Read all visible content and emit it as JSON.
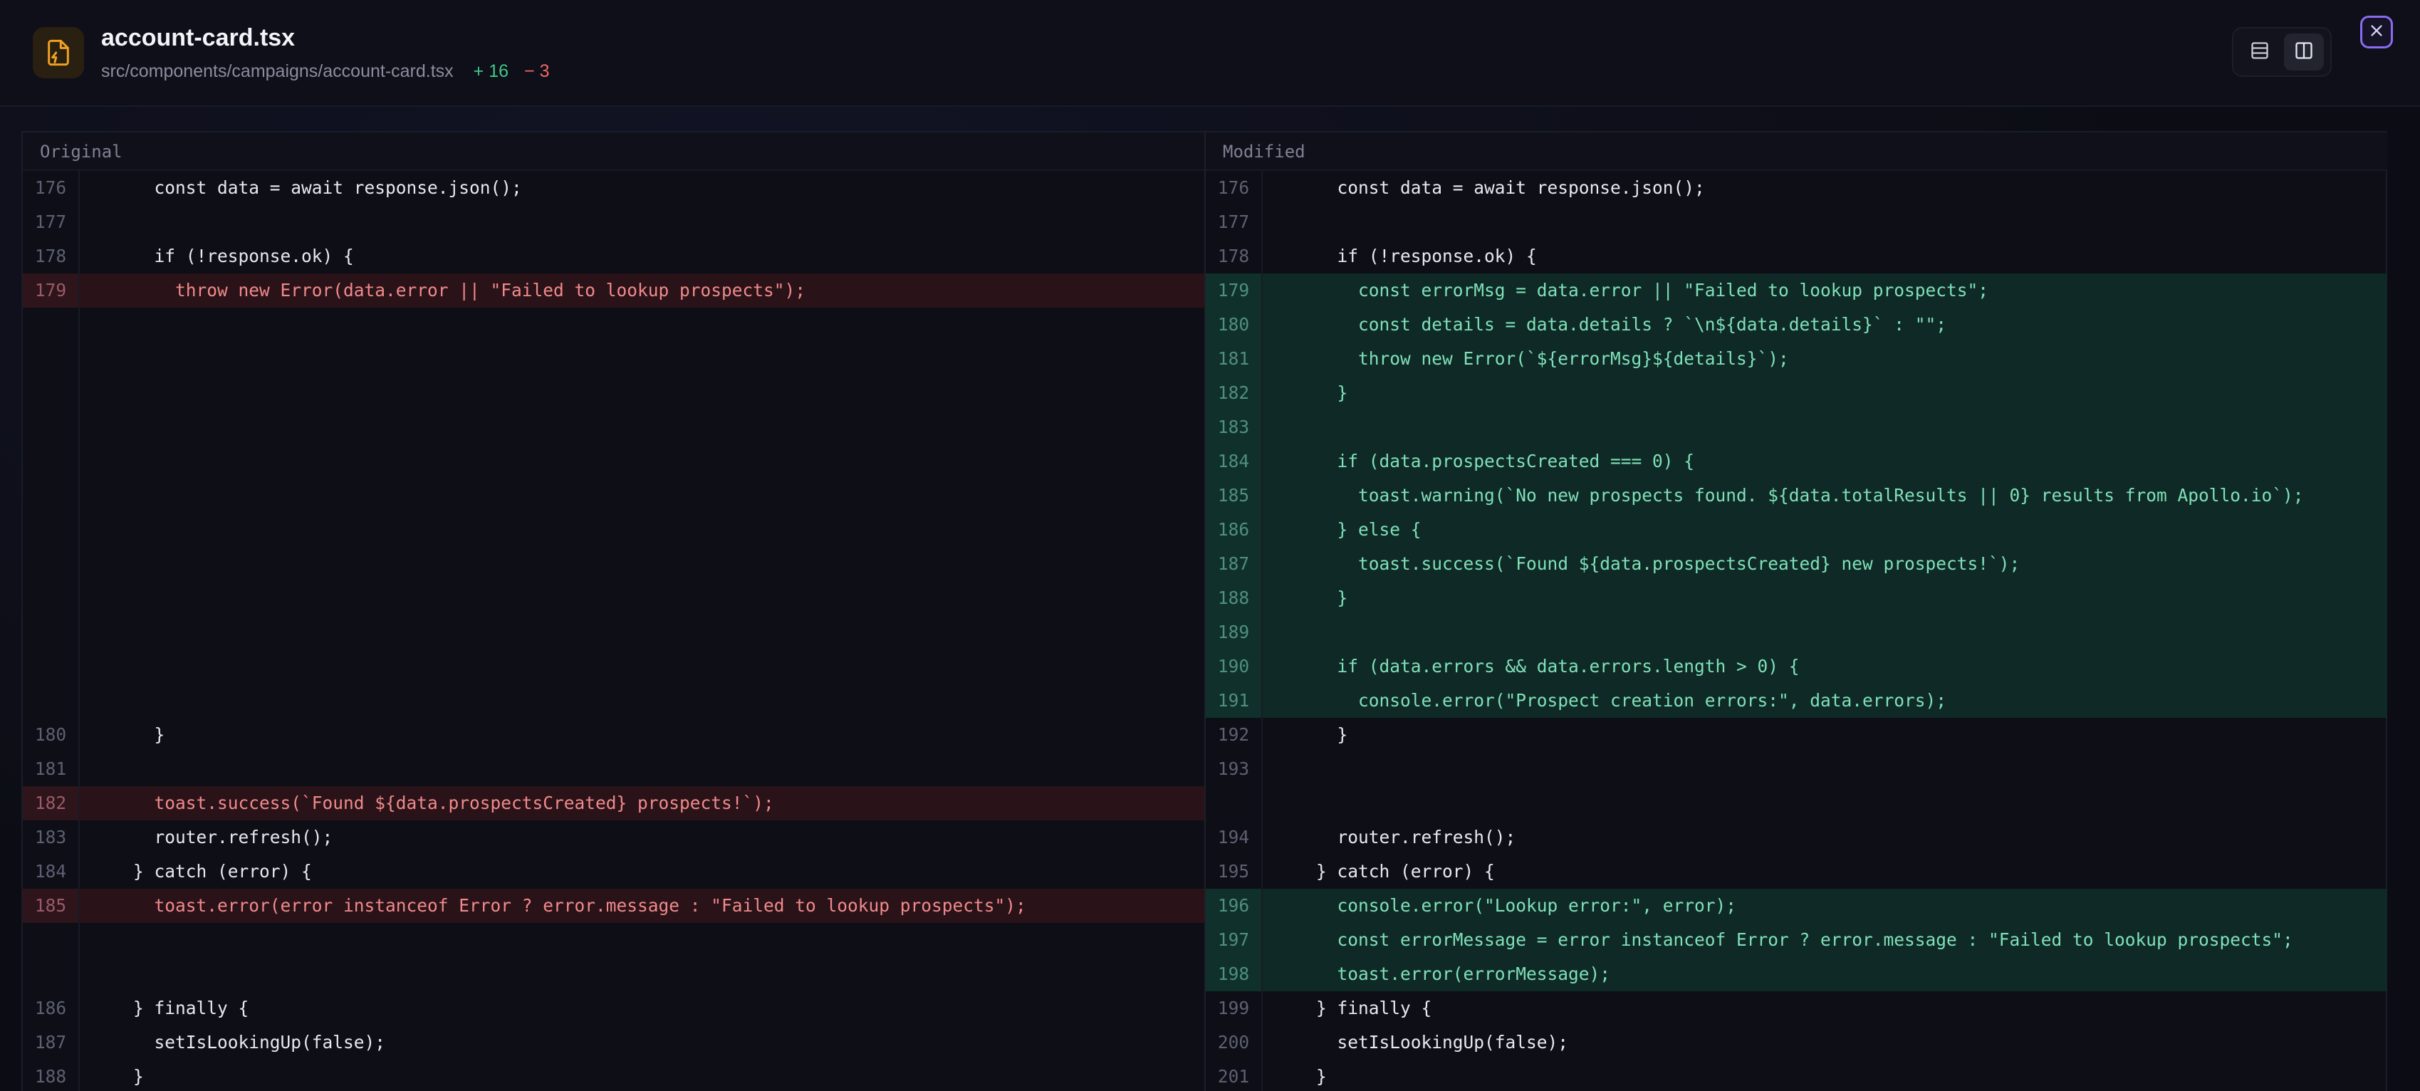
{
  "header": {
    "file_name": "account-card.tsx",
    "file_path": "src/components/campaigns/account-card.tsx",
    "additions": "+ 16",
    "deletions": "− 3"
  },
  "panes": {
    "left_label": "Original",
    "right_label": "Modified"
  },
  "left_lines": [
    {
      "n": "176",
      "t": "      const data = await response.json();",
      "k": "ctx"
    },
    {
      "n": "177",
      "t": "",
      "k": "ctx"
    },
    {
      "n": "178",
      "t": "      if (!response.ok) {",
      "k": "ctx"
    },
    {
      "n": "179",
      "t": "        throw new Error(data.error || \"Failed to lookup prospects\");",
      "k": "del"
    },
    {
      "n": "",
      "t": "",
      "k": "empty"
    },
    {
      "n": "",
      "t": "",
      "k": "empty"
    },
    {
      "n": "",
      "t": "",
      "k": "empty"
    },
    {
      "n": "",
      "t": "",
      "k": "empty"
    },
    {
      "n": "",
      "t": "",
      "k": "empty"
    },
    {
      "n": "",
      "t": "",
      "k": "empty"
    },
    {
      "n": "",
      "t": "",
      "k": "empty"
    },
    {
      "n": "",
      "t": "",
      "k": "empty"
    },
    {
      "n": "",
      "t": "",
      "k": "empty"
    },
    {
      "n": "",
      "t": "",
      "k": "empty"
    },
    {
      "n": "",
      "t": "",
      "k": "empty"
    },
    {
      "n": "",
      "t": "",
      "k": "empty"
    },
    {
      "n": "180",
      "t": "      }",
      "k": "ctx"
    },
    {
      "n": "181",
      "t": "",
      "k": "ctx"
    },
    {
      "n": "182",
      "t": "      toast.success(`Found ${data.prospectsCreated} prospects!`);",
      "k": "del"
    },
    {
      "n": "183",
      "t": "      router.refresh();",
      "k": "ctx"
    },
    {
      "n": "184",
      "t": "    } catch (error) {",
      "k": "ctx"
    },
    {
      "n": "185",
      "t": "      toast.error(error instanceof Error ? error.message : \"Failed to lookup prospects\");",
      "k": "del"
    },
    {
      "n": "",
      "t": "",
      "k": "empty"
    },
    {
      "n": "",
      "t": "",
      "k": "empty"
    },
    {
      "n": "186",
      "t": "    } finally {",
      "k": "ctx"
    },
    {
      "n": "187",
      "t": "      setIsLookingUp(false);",
      "k": "ctx"
    },
    {
      "n": "188",
      "t": "    }",
      "k": "ctx"
    }
  ],
  "right_lines": [
    {
      "n": "176",
      "t": "      const data = await response.json();",
      "k": "ctx"
    },
    {
      "n": "177",
      "t": "",
      "k": "ctx"
    },
    {
      "n": "178",
      "t": "      if (!response.ok) {",
      "k": "ctx"
    },
    {
      "n": "179",
      "t": "        const errorMsg = data.error || \"Failed to lookup prospects\";",
      "k": "add"
    },
    {
      "n": "180",
      "t": "        const details = data.details ? `\\n${data.details}` : \"\";",
      "k": "add"
    },
    {
      "n": "181",
      "t": "        throw new Error(`${errorMsg}${details}`);",
      "k": "add"
    },
    {
      "n": "182",
      "t": "      }",
      "k": "add"
    },
    {
      "n": "183",
      "t": "",
      "k": "add"
    },
    {
      "n": "184",
      "t": "      if (data.prospectsCreated === 0) {",
      "k": "add"
    },
    {
      "n": "185",
      "t": "        toast.warning(`No new prospects found. ${data.totalResults || 0} results from Apollo.io`);",
      "k": "add"
    },
    {
      "n": "186",
      "t": "      } else {",
      "k": "add"
    },
    {
      "n": "187",
      "t": "        toast.success(`Found ${data.prospectsCreated} new prospects!`);",
      "k": "add"
    },
    {
      "n": "188",
      "t": "      }",
      "k": "add"
    },
    {
      "n": "189",
      "t": "",
      "k": "add"
    },
    {
      "n": "190",
      "t": "      if (data.errors && data.errors.length > 0) {",
      "k": "add"
    },
    {
      "n": "191",
      "t": "        console.error(\"Prospect creation errors:\", data.errors);",
      "k": "add"
    },
    {
      "n": "192",
      "t": "      }",
      "k": "ctx"
    },
    {
      "n": "193",
      "t": "",
      "k": "ctx"
    },
    {
      "n": "",
      "t": "",
      "k": "empty"
    },
    {
      "n": "194",
      "t": "      router.refresh();",
      "k": "ctx"
    },
    {
      "n": "195",
      "t": "    } catch (error) {",
      "k": "ctx"
    },
    {
      "n": "196",
      "t": "      console.error(\"Lookup error:\", error);",
      "k": "add"
    },
    {
      "n": "197",
      "t": "      const errorMessage = error instanceof Error ? error.message : \"Failed to lookup prospects\";",
      "k": "add"
    },
    {
      "n": "198",
      "t": "      toast.error(errorMessage);",
      "k": "add"
    },
    {
      "n": "199",
      "t": "    } finally {",
      "k": "ctx"
    },
    {
      "n": "200",
      "t": "      setIsLookingUp(false);",
      "k": "ctx"
    },
    {
      "n": "201",
      "t": "    }",
      "k": "ctx"
    }
  ],
  "colors": {
    "accent": "#8b6cf0",
    "file_icon": "#f0a020",
    "added": "#3fc88b",
    "removed": "#f06868"
  },
  "icons": {
    "file": "file-code-icon",
    "unified_view": "rows-icon",
    "split_view": "columns-icon",
    "close": "close-icon"
  }
}
